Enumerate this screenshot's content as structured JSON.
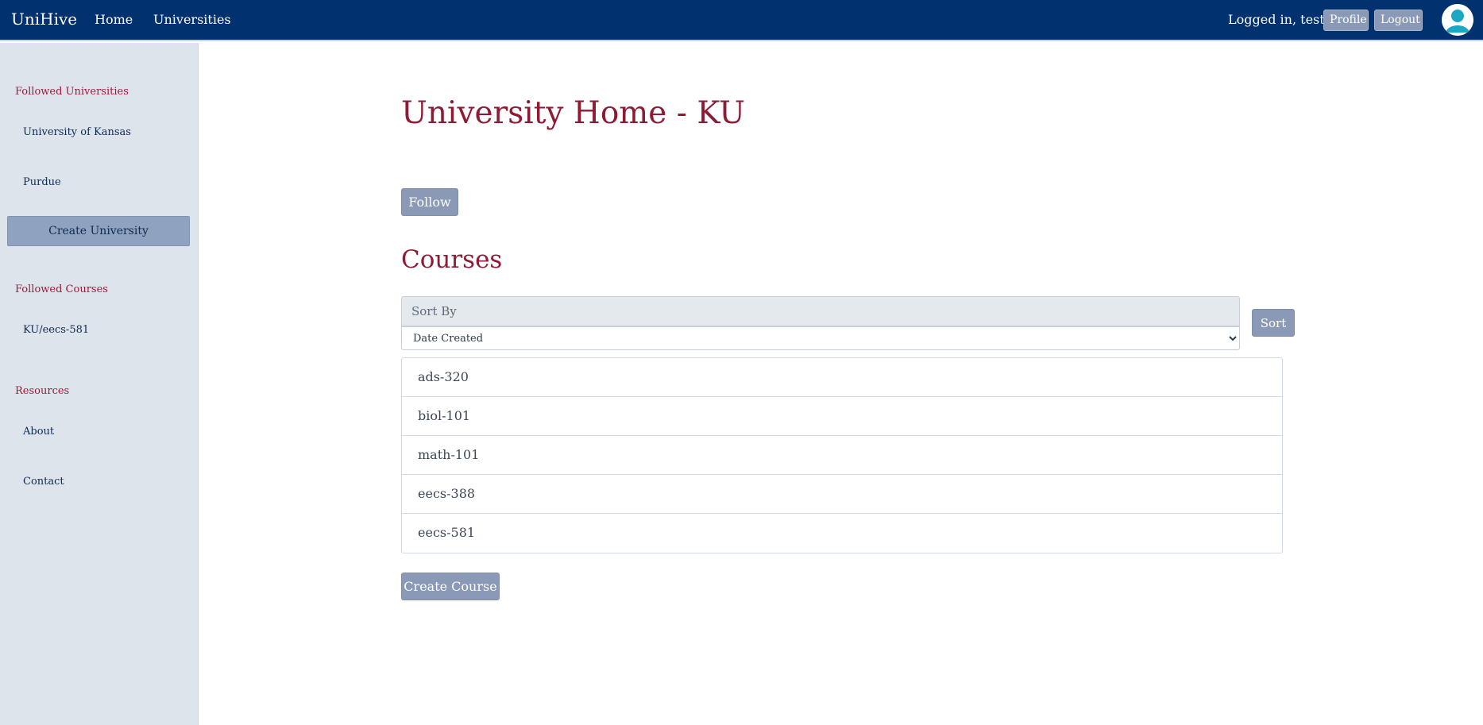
{
  "navbar": {
    "brand": "UniHive",
    "links": [
      "Home",
      "Universities"
    ],
    "logged_in_text": "Logged in, test",
    "profile_label": "Profile",
    "logout_label": "Logout",
    "avatar_icon": "user-avatar-icon",
    "background": "#02316f"
  },
  "sidebar": {
    "followed_universities_heading": "Followed Universities",
    "universities": [
      "University of Kansas",
      "Purdue"
    ],
    "create_university_label": "Create University",
    "followed_courses_heading": "Followed Courses",
    "courses": [
      "KU/eecs-581"
    ],
    "resources_heading": "Resources",
    "resources": [
      "About",
      "Contact"
    ]
  },
  "main": {
    "title": "University Home - KU",
    "follow_label": "Follow",
    "courses_heading": "Courses",
    "sort": {
      "label": "Sort By",
      "selected": "Date Created",
      "button_label": "Sort"
    },
    "course_list": [
      "ads-320",
      "biol-101",
      "math-101",
      "eecs-388",
      "eecs-581"
    ],
    "create_course_label": "Create Course"
  },
  "colors": {
    "accent_red": "#8f1a33",
    "button": "#8a9ab6",
    "sidebar_bg": "#dde4ec"
  }
}
